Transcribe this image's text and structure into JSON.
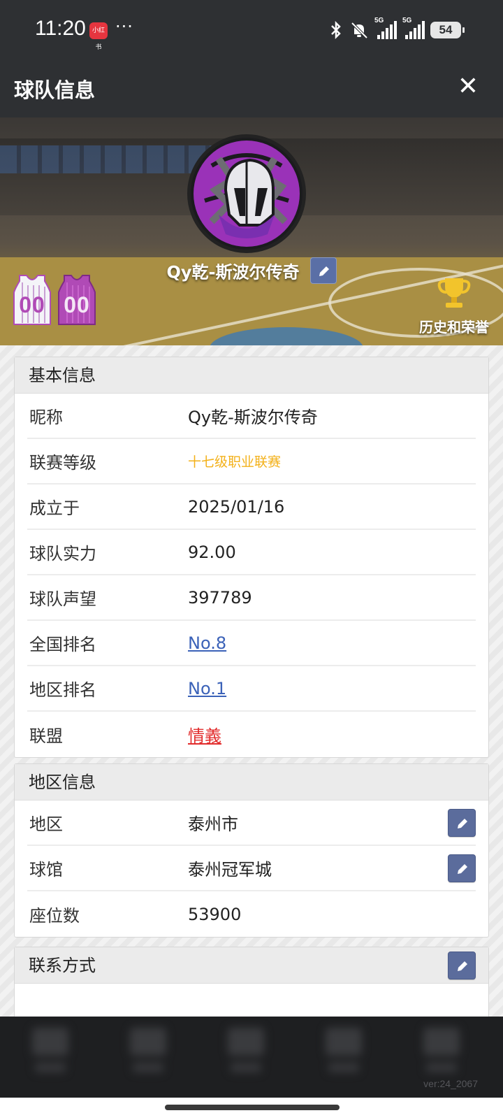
{
  "status_bar": {
    "time": "11:20",
    "app_badge": "小红书",
    "more": "···",
    "signal1_tag": "5G",
    "signal2_tag": "5G",
    "battery": "54"
  },
  "header": {
    "title": "球队信息",
    "close": "✕"
  },
  "hero": {
    "team_name": "Qy乾-斯波尔传奇",
    "jersey_home_number": "00",
    "jersey_away_number": "00",
    "honor_label": "历史和荣誉"
  },
  "basic_info": {
    "title": "基本信息",
    "rows": [
      {
        "key": "昵称",
        "value": "Qy乾-斯波尔传奇"
      },
      {
        "key": "联赛等级",
        "value": "十七级职业联赛"
      },
      {
        "key": "成立于",
        "value": "2025/01/16"
      },
      {
        "key": "球队实力",
        "value": "92.00"
      },
      {
        "key": "球队声望",
        "value": "397789"
      },
      {
        "key": "全国排名",
        "value": "No.8"
      },
      {
        "key": "地区排名",
        "value": "No.1"
      },
      {
        "key": "联盟",
        "value": "情義"
      }
    ]
  },
  "region_info": {
    "title": "地区信息",
    "rows": [
      {
        "key": "地区",
        "value": "泰州市"
      },
      {
        "key": "球馆",
        "value": "泰州冠军城"
      },
      {
        "key": "座位数",
        "value": "53900"
      }
    ]
  },
  "contact": {
    "title": "联系方式"
  },
  "footer": {
    "version": "ver:24_2067"
  },
  "colors": {
    "accent_orange": "#f3b11a",
    "link_blue": "#3b62b8",
    "alliance_red": "#e22d2d",
    "edit_button": "#5b6c9c"
  }
}
